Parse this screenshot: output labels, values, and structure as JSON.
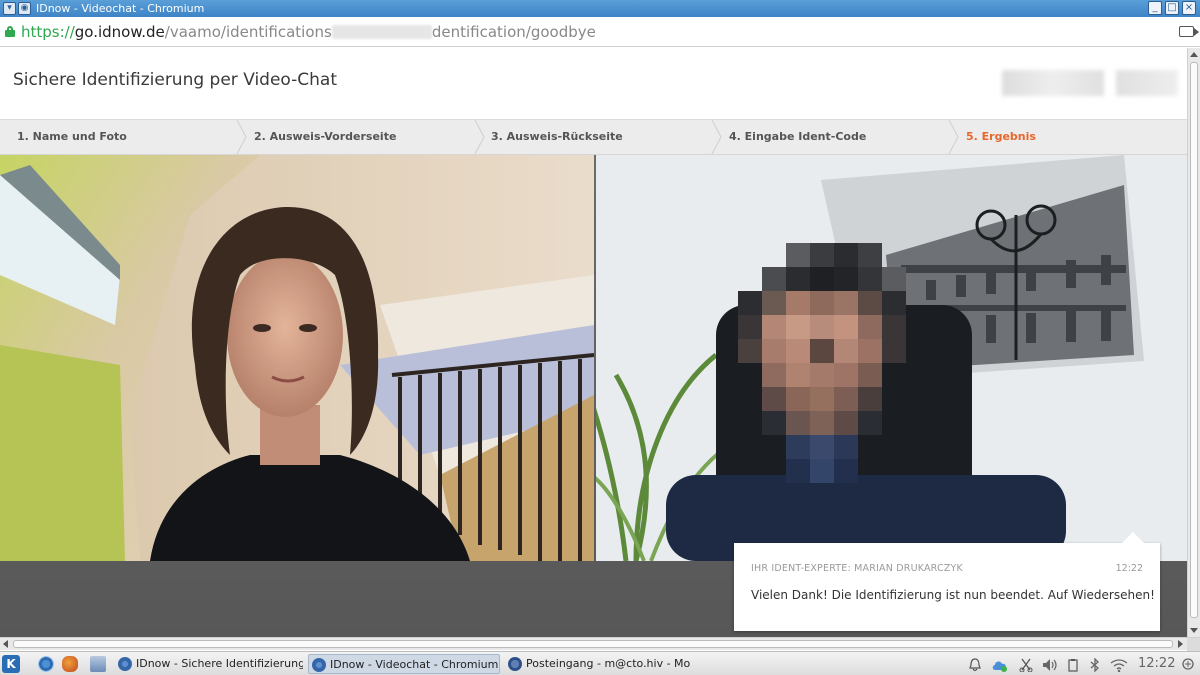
{
  "window": {
    "title": "IDnow - Videochat - Chromium",
    "controls": [
      "_",
      "□",
      "×"
    ]
  },
  "address": {
    "scheme": "https://",
    "host": "go.idnow.de",
    "path_before": "/vaamo/identifications",
    "path_after": "dentification/goodbye"
  },
  "page": {
    "title": "Sichere Identifizierung per Video-Chat"
  },
  "steps": [
    {
      "label": "1. Name und Foto",
      "active": false
    },
    {
      "label": "2. Ausweis-Vorderseite",
      "active": false
    },
    {
      "label": "3. Ausweis-Rückseite",
      "active": false
    },
    {
      "label": "4. Eingabe Ident-Code",
      "active": false
    },
    {
      "label": "5. Ergebnis",
      "active": true
    }
  ],
  "chat": {
    "author": "IHR IDENT-EXPERTE: MARIAN DRUKARCZYK",
    "time": "12:22",
    "message": "Vielen Dank! Die Identifizierung ist nun beendet. Auf Wiedersehen!"
  },
  "taskbar": {
    "start_label": "K",
    "tasks": [
      {
        "label": "IDnow - Sichere Identifizierung",
        "active": false
      },
      {
        "label": "IDnow - Videochat - Chromium",
        "active": true
      },
      {
        "label": "Posteingang - m@cto.hiv - Mo",
        "active": false
      }
    ],
    "clock": "12:22"
  },
  "colors": {
    "accent_active_step": "#e8672a",
    "secure_green": "#2fa84f",
    "titlebar": "#3e84c6"
  }
}
